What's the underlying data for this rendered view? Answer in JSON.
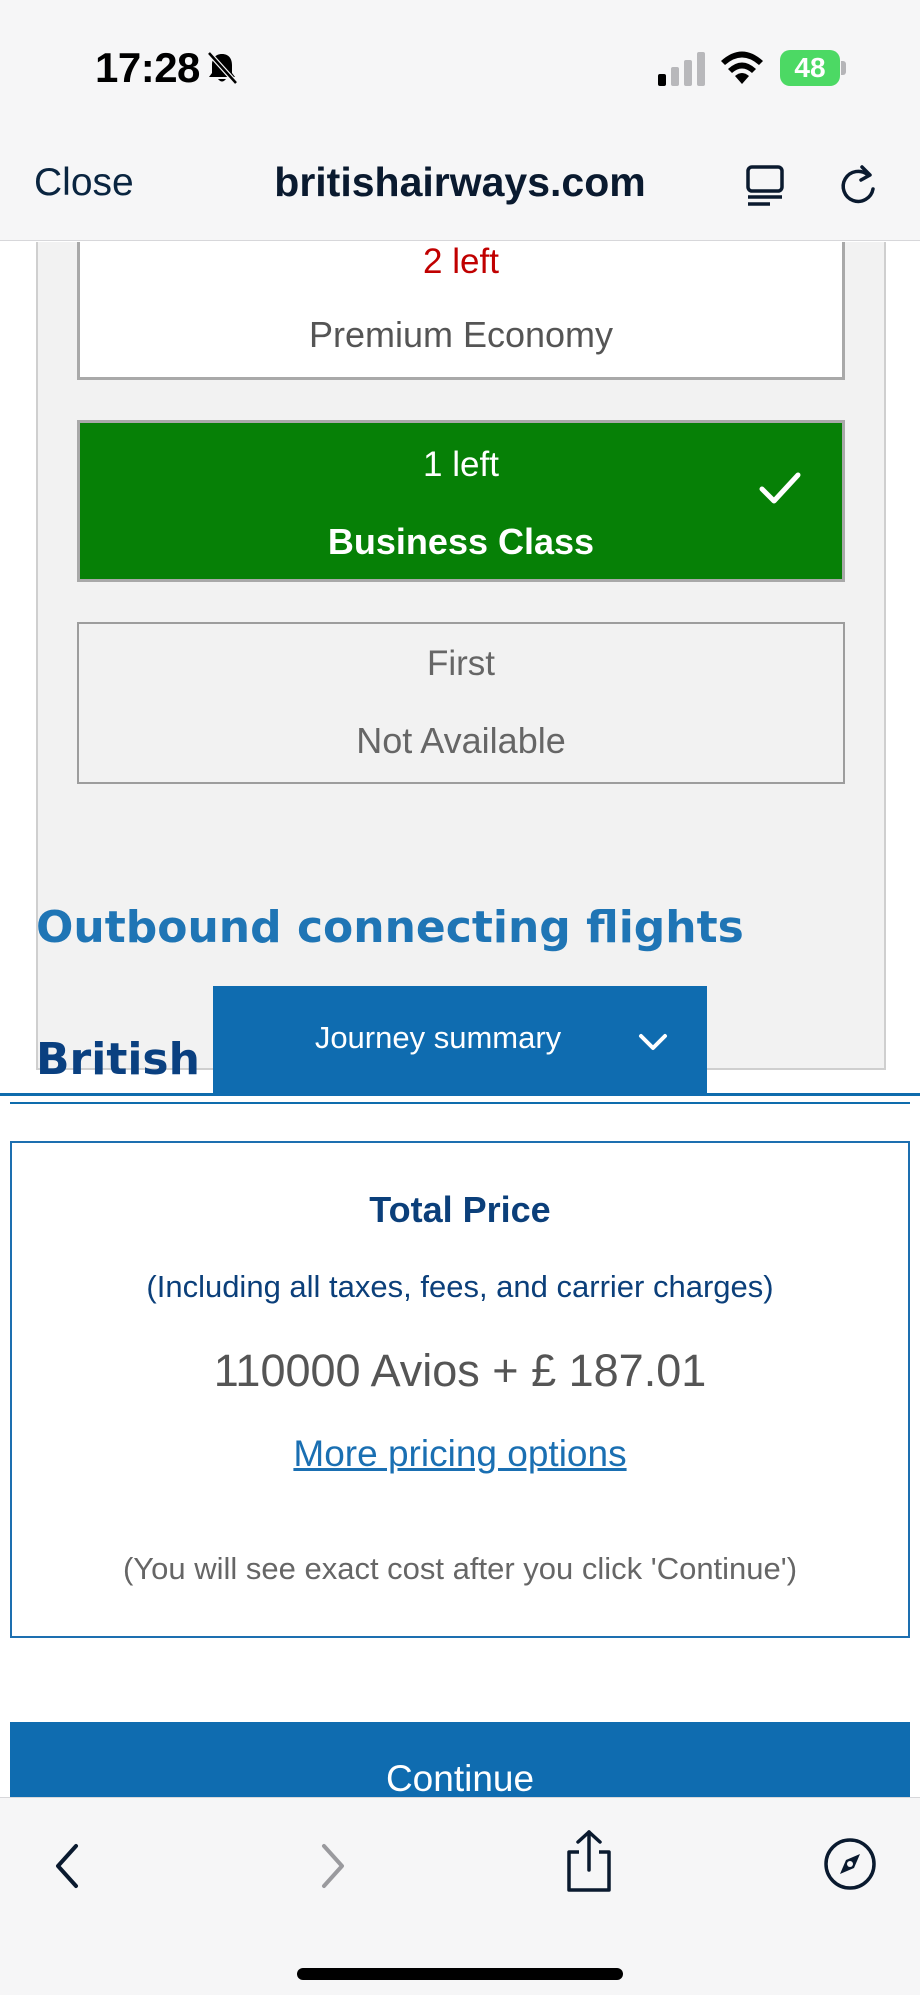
{
  "status_bar": {
    "time": "17:28",
    "battery_level": "48",
    "icons": [
      "bell-slash-icon",
      "signal-icon",
      "wifi-icon",
      "battery-charging-icon"
    ]
  },
  "browser": {
    "close_label": "Close",
    "url": "britishairways.com",
    "icons": [
      "reader-icon",
      "reload-icon"
    ]
  },
  "cabins": [
    {
      "availability": "2 left",
      "name": "Premium Economy",
      "selected": false
    },
    {
      "availability": "1 left",
      "name": "Business Class",
      "selected": true
    },
    {
      "availability": "First",
      "name": "Not Available",
      "selected": false
    }
  ],
  "sections": {
    "outbound_heading": "Outbound connecting flights",
    "carrier_heading": "British Ai"
  },
  "journey_summary": {
    "label": "Journey summary"
  },
  "price": {
    "title": "Total Price",
    "subtitle": "(Including all taxes, fees, and carrier charges)",
    "value": "110000 Avios + £ 187.01",
    "more_options_link": "More pricing options",
    "note": "(You will see exact cost after you click 'Continue')"
  },
  "actions": {
    "continue_label": "Continue"
  },
  "toolbar": {
    "icons": [
      "back-icon",
      "forward-icon",
      "share-icon",
      "compass-icon"
    ]
  },
  "colors": {
    "brand_blue": "#0f6cb0",
    "selected_green": "#068006",
    "warning_red": "#c00000",
    "heading_blue": "#1f75b5"
  }
}
